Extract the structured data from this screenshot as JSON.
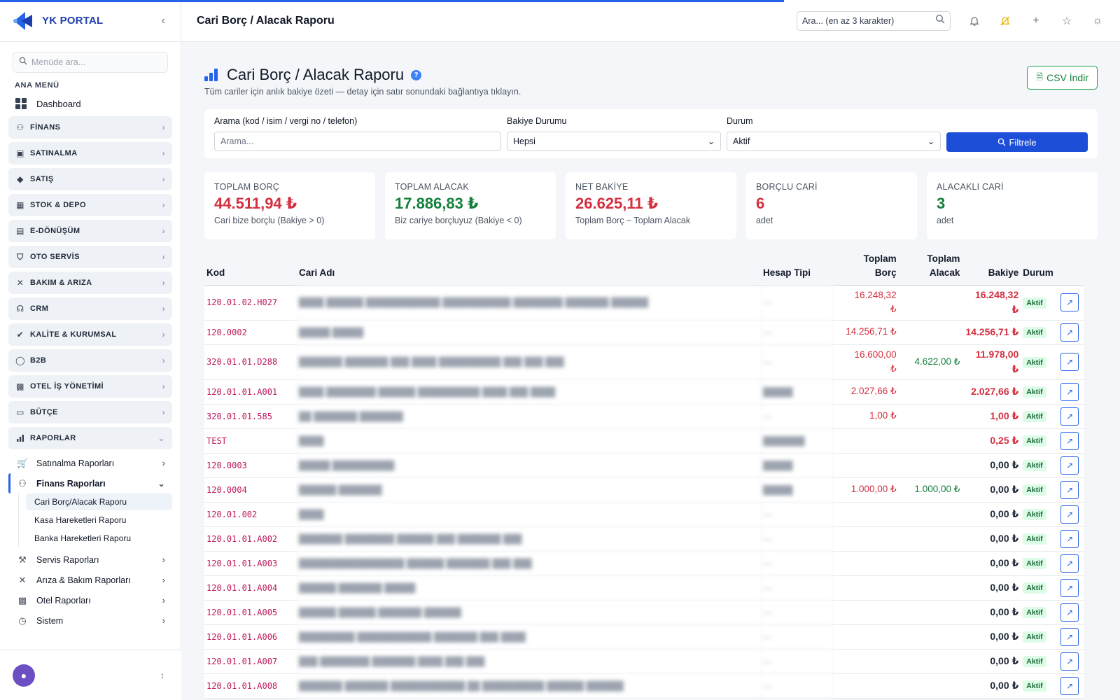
{
  "app": {
    "name": "YK PORTAL"
  },
  "colors": {
    "accent": "#2563eb",
    "debit": "#d32f3f",
    "credit": "#15803d",
    "code": "#be185d"
  },
  "sidebar": {
    "search_placeholder": "Menüde ara...",
    "section_label": "ANA MENÜ",
    "dashboard_label": "Dashboard",
    "groups": [
      {
        "label": "FİNANS",
        "icon": "finance-icon"
      },
      {
        "label": "SATINALMA",
        "icon": "bag-icon"
      },
      {
        "label": "SATIŞ",
        "icon": "tag-icon"
      },
      {
        "label": "STOK & DEPO",
        "icon": "box-icon"
      },
      {
        "label": "E-DÖNÜŞÜM",
        "icon": "document-icon"
      },
      {
        "label": "OTO SERVİS",
        "icon": "car-icon"
      },
      {
        "label": "BAKIM & ARIZA",
        "icon": "tools-icon"
      },
      {
        "label": "CRM",
        "icon": "headset-icon"
      },
      {
        "label": "KALİTE & KURUMSAL",
        "icon": "badge-icon"
      },
      {
        "label": "B2B",
        "icon": "globe-icon"
      },
      {
        "label": "OTEL İŞ YÖNETİMİ",
        "icon": "building-icon"
      },
      {
        "label": "BÜTÇE",
        "icon": "wallet-icon"
      },
      {
        "label": "RAPORLAR",
        "icon": "chart-icon"
      }
    ],
    "reports": [
      {
        "label": "Satınalma Raporları"
      },
      {
        "label": "Finans Raporları"
      },
      {
        "label": "Servis Raporları"
      },
      {
        "label": "Arıza & Bakım Raporları"
      },
      {
        "label": "Otel Raporları"
      },
      {
        "label": "Sistem"
      }
    ],
    "finance_reports": [
      {
        "label": "Cari Borç/Alacak Raporu"
      },
      {
        "label": "Kasa Hareketleri Raporu"
      },
      {
        "label": "Banka Hareketleri Raporu"
      }
    ]
  },
  "header": {
    "title": "Cari Borç / Alacak Raporu",
    "search_placeholder": "Ara... (en az 3 karakter)"
  },
  "page": {
    "title": "Cari Borç / Alacak Raporu",
    "subtitle": "Tüm cariler için anlık bakiye özeti — detay için satır sonundaki bağlantıya tıklayın.",
    "csv_label": "CSV İndir"
  },
  "filters": {
    "search_label": "Arama (kod / isim / vergi no / telefon)",
    "search_placeholder": "Arama...",
    "balance_label": "Bakiye Durumu",
    "balance_value": "Hepsi",
    "status_label": "Durum",
    "status_value": "Aktif",
    "button_label": "Filtrele"
  },
  "cards": [
    {
      "label": "TOPLAM BORÇ",
      "value": "44.511,94 ₺",
      "sub": "Cari bize borçlu (Bakiye > 0)"
    },
    {
      "label": "TOPLAM ALACAK",
      "value": "17.886,83 ₺",
      "sub": "Biz cariye borçluyuz (Bakiye < 0)"
    },
    {
      "label": "NET BAKİYE",
      "value": "26.625,11 ₺",
      "sub": "Toplam Borç − Toplam Alacak"
    },
    {
      "label": "BORÇLU CARİ",
      "value": "6",
      "sub": "adet"
    },
    {
      "label": "ALACAKLI CARİ",
      "value": "3",
      "sub": "adet"
    }
  ],
  "table": {
    "columns": {
      "code": "Kod",
      "name": "Cari Adı",
      "type": "Hesap Tipi",
      "debit_1": "Toplam",
      "debit_2": "Borç",
      "credit_1": "Toplam",
      "credit_2": "Alacak",
      "balance": "Bakiye",
      "status": "Durum"
    },
    "rows": [
      {
        "code": "120.01.02.H027",
        "name": "████ ██████ ████████████ ███████████ ████████ ███████ ██████",
        "type": "—",
        "debit": "16.248,32 ₺",
        "credit": "",
        "balance": "16.248,32 ₺",
        "status": "Aktif",
        "debit_wrap": true,
        "balance_wrap": true
      },
      {
        "code": "120.0002",
        "name": "█████ █████",
        "type": "—",
        "debit": "14.256,71 ₺",
        "credit": "",
        "balance": "14.256,71 ₺",
        "status": "Aktif"
      },
      {
        "code": "320.01.01.D288",
        "name": "███████ ███████ ███ ████ ██████████ ███ ███ ███",
        "type": "—",
        "debit": "16.600,00 ₺",
        "credit": "4.622,00 ₺",
        "balance": "11.978,00 ₺",
        "status": "Aktif",
        "debit_wrap": true,
        "balance_wrap": true
      },
      {
        "code": "120.01.01.A001",
        "name": "████ ████████ ██████ ██████████ ████ ███ ████",
        "type": "█████",
        "debit": "2.027,66 ₺",
        "credit": "",
        "balance": "2.027,66 ₺",
        "status": "Aktif"
      },
      {
        "code": "320.01.01.585",
        "name": "██ ███████ ███████",
        "type": "—",
        "debit": "1,00 ₺",
        "credit": "",
        "balance": "1,00 ₺",
        "status": "Aktif"
      },
      {
        "code": "TEST",
        "name": "████",
        "type": "███████",
        "debit": "",
        "credit": "",
        "balance": "0,25 ₺",
        "status": "Aktif"
      },
      {
        "code": "120.0003",
        "name": "█████ ██████████",
        "type": "█████",
        "debit": "",
        "credit": "",
        "balance": "0,00 ₺",
        "status": "Aktif",
        "zero": true
      },
      {
        "code": "120.0004",
        "name": "██████ ███████",
        "type": "█████",
        "debit": "1.000,00 ₺",
        "credit": "1.000,00 ₺",
        "balance": "0,00 ₺",
        "status": "Aktif",
        "zero": true
      },
      {
        "code": "120.01.002",
        "name": "████",
        "type": "—",
        "debit": "",
        "credit": "",
        "balance": "0,00 ₺",
        "status": "Aktif",
        "zero": true
      },
      {
        "code": "120.01.01.A002",
        "name": "███████ ████████ ██████ ███ ███████ ███",
        "type": "—",
        "debit": "",
        "credit": "",
        "balance": "0,00 ₺",
        "status": "Aktif",
        "zero": true
      },
      {
        "code": "120.01.01.A003",
        "name": "█████████████████ ██████ ███████ ███ ███",
        "type": "—",
        "debit": "",
        "credit": "",
        "balance": "0,00 ₺",
        "status": "Aktif",
        "zero": true
      },
      {
        "code": "120.01.01.A004",
        "name": "██████ ███████ █████",
        "type": "—",
        "debit": "",
        "credit": "",
        "balance": "0,00 ₺",
        "status": "Aktif",
        "zero": true
      },
      {
        "code": "120.01.01.A005",
        "name": "██████ ██████ ███████ ██████",
        "type": "—",
        "debit": "",
        "credit": "",
        "balance": "0,00 ₺",
        "status": "Aktif",
        "zero": true
      },
      {
        "code": "120.01.01.A006",
        "name": "█████████ ████████████ ███████ ███ ████",
        "type": "—",
        "debit": "",
        "credit": "",
        "balance": "0,00 ₺",
        "status": "Aktif",
        "zero": true
      },
      {
        "code": "120.01.01.A007",
        "name": "███ ████████ ███████ ████ ███ ███",
        "type": "—",
        "debit": "",
        "credit": "",
        "balance": "0,00 ₺",
        "status": "Aktif",
        "zero": true
      },
      {
        "code": "120.01.01.A008",
        "name": "███████ ███████ ████████████ ██ ██████████ ██████ ██████",
        "type": "—",
        "debit": "",
        "credit": "",
        "balance": "0,00 ₺",
        "status": "Aktif",
        "zero": true
      }
    ]
  }
}
